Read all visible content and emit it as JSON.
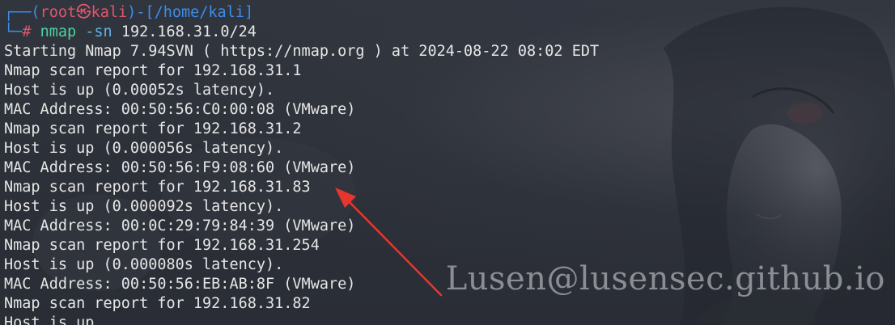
{
  "prompt": {
    "box_top": "┌──(",
    "user": "root㉿kali",
    "sep": ")-[",
    "path": "/home/kali",
    "close": "]",
    "box_bottom": "└─",
    "hash": "#"
  },
  "command": {
    "name": "nmap",
    "flag": "-sn",
    "target": "192.168.31.0/24"
  },
  "output": [
    "Starting Nmap 7.94SVN ( https://nmap.org ) at 2024-08-22 08:02 EDT",
    "Nmap scan report for 192.168.31.1",
    "Host is up (0.00052s latency).",
    "MAC Address: 00:50:56:C0:00:08 (VMware)",
    "Nmap scan report for 192.168.31.2",
    "Host is up (0.000056s latency).",
    "MAC Address: 00:50:56:F9:08:60 (VMware)",
    "Nmap scan report for 192.168.31.83",
    "Host is up (0.000092s latency).",
    "MAC Address: 00:0C:29:79:84:39 (VMware)",
    "Nmap scan report for 192.168.31.254",
    "Host is up (0.000080s latency).",
    "MAC Address: 00:50:56:EB:AB:8F (VMware)",
    "Nmap scan report for 192.168.31.82",
    "Host is up."
  ],
  "watermark": "Lusen@lusensec.github.io",
  "colors": {
    "prompt_red": "#e0566b",
    "prompt_blue": "#3b8eea",
    "command_green": "#4fd1a5",
    "arrow_red": "#e8362f",
    "text": "#e6e6e6"
  }
}
